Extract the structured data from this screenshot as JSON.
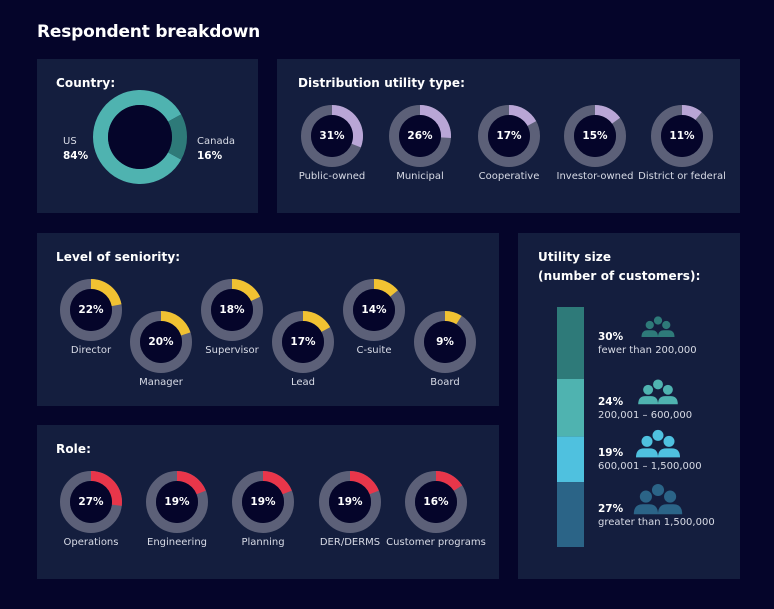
{
  "page_title": "Respondent breakdown",
  "colors": {
    "background": "#05052a",
    "panel": "#141e3e",
    "track": "#5c6078",
    "hole": "#05052a",
    "country_us": "#4fb3b0",
    "country_canada": "#2e7a79",
    "utility_type": "#b9a6d6",
    "seniority": "#f1c232",
    "role": "#e8364a"
  },
  "chart_data": [
    {
      "type": "pie",
      "title": "Country:",
      "categories": [
        "US",
        "Canada"
      ],
      "values": [
        84,
        16
      ],
      "labels": [
        "84%",
        "16%"
      ]
    },
    {
      "type": "pie",
      "title": "Distribution utility type:",
      "categories": [
        "Public-owned",
        "Municipal",
        "Cooperative",
        "Investor-owned",
        "District or federal"
      ],
      "values": [
        31,
        26,
        17,
        15,
        11
      ],
      "labels": [
        "31%",
        "26%",
        "17%",
        "15%",
        "11%"
      ]
    },
    {
      "type": "pie",
      "title": "Level of seniority:",
      "categories": [
        "Director",
        "Manager",
        "Supervisor",
        "Lead",
        "C-suite",
        "Board"
      ],
      "values": [
        22,
        20,
        18,
        17,
        14,
        9
      ],
      "labels": [
        "22%",
        "20%",
        "18%",
        "17%",
        "14%",
        "9%"
      ]
    },
    {
      "type": "pie",
      "title": "Role:",
      "categories": [
        "Operations",
        "Engineering",
        "Planning",
        "DER/DERMS",
        "Customer programs"
      ],
      "values": [
        27,
        19,
        19,
        19,
        16
      ],
      "labels": [
        "27%",
        "19%",
        "19%",
        "19%",
        "16%"
      ]
    },
    {
      "type": "bar",
      "title": "Utility size (number of customers):",
      "title_lines": [
        "Utility size",
        "(number of customers):"
      ],
      "categories": [
        "fewer than 200,000",
        "200,001 – 600,000",
        "600,001 – 1,500,000",
        "greater than 1,500,000"
      ],
      "values": [
        30,
        24,
        19,
        27
      ],
      "labels": [
        "30%",
        "24%",
        "19%",
        "27%"
      ],
      "colors": [
        "#2e7a79",
        "#4fb3b0",
        "#4fc1df",
        "#2b6487"
      ],
      "stacked": true
    }
  ]
}
